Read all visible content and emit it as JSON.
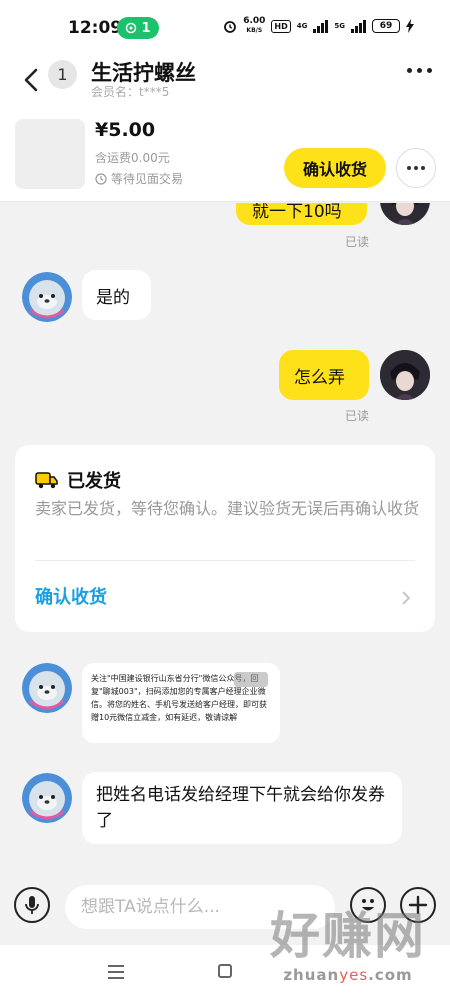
{
  "status_bar": {
    "time": "12:09",
    "pill_count": "1",
    "speed_value": "6.00",
    "speed_unit": "KB/S",
    "hd": "HD",
    "net_4g": "4G",
    "net_5g": "5G",
    "battery": "69"
  },
  "header": {
    "unread_count": "1",
    "title": "生活拧螺丝",
    "member": "会员名：t***5"
  },
  "product": {
    "price": "¥5.00",
    "shipping": "含运费0.00元",
    "trade_mode": "等待见面交易",
    "confirm_button": "确认收货"
  },
  "chat": {
    "partial_text": "就一下10吗",
    "read_1": "已读",
    "msg_in_1": "是的",
    "msg_out_1": "怎么弄",
    "read_2": "已读",
    "ship_card": {
      "title": "已发货",
      "desc": "卖家已发货，等待您确认。建议验货无误后再确认收货",
      "action": "确认收货"
    },
    "image_text": "关注\"中国建设银行山东省分行\"微信公众号，回复\"聊城003\"，扫码添加您的专属客户经理企业微信。将您的姓名、手机号发送给客户经理，即可获赠10元微信立减金，如有延迟，敬请谅解",
    "msg_in_2": "把姓名电话发给经理下午就会给你发券了"
  },
  "input_bar": {
    "placeholder": "想跟TA说点什么..."
  },
  "watermark": {
    "text": "好赚网",
    "url_a": "zhuan",
    "url_b": "yes",
    "url_c": ".com"
  },
  "colors": {
    "accent_yellow": "#ffe11a",
    "link_blue": "#1a9fe0",
    "status_green": "#1cc26b"
  }
}
